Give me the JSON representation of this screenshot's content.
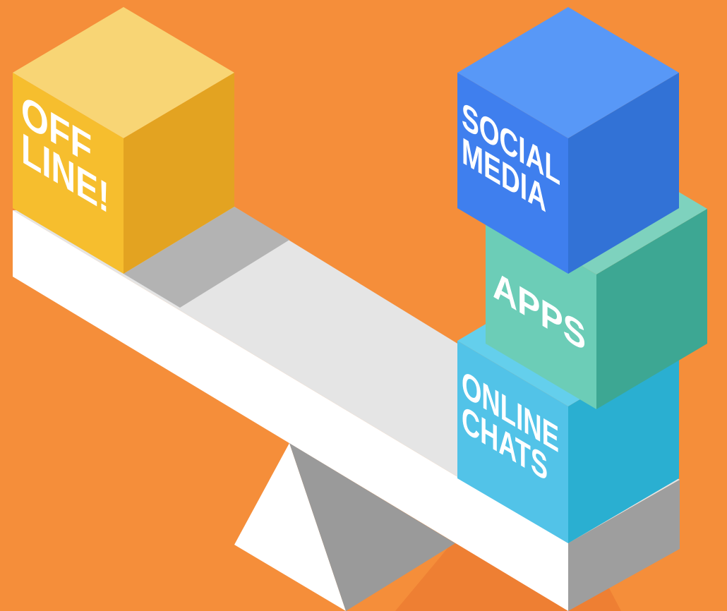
{
  "scene": {
    "background": "#F58E3A",
    "shadow": "#EE7F33"
  },
  "seesaw": {
    "beam_top": "#E5E5E5",
    "beam_top_shadow": "#B3B3B3",
    "beam_front": "#FFFFFF",
    "beam_end": "#9E9E9E",
    "fulcrum_light": "#FFFFFF",
    "fulcrum_dark": "#9A9A9A"
  },
  "cubes": {
    "offline": {
      "line1": "OFF",
      "line2": "LINE!",
      "top": "#F8D575",
      "front": "#F6BE2E",
      "side": "#E3A321"
    },
    "social_media": {
      "line1": "SOCIAL",
      "line2": "MEDIA",
      "top": "#5898F7",
      "front": "#3F7FEE",
      "side": "#3272D6"
    },
    "apps": {
      "line1": "APPS",
      "top": "#7ED2BE",
      "front": "#6CCDB7",
      "side": "#3DA793"
    },
    "online_chats": {
      "line1": "ONLINE",
      "line2": "CHATS",
      "top": "#64CFEC",
      "front": "#52C3E8",
      "side": "#2AAFD1"
    }
  }
}
